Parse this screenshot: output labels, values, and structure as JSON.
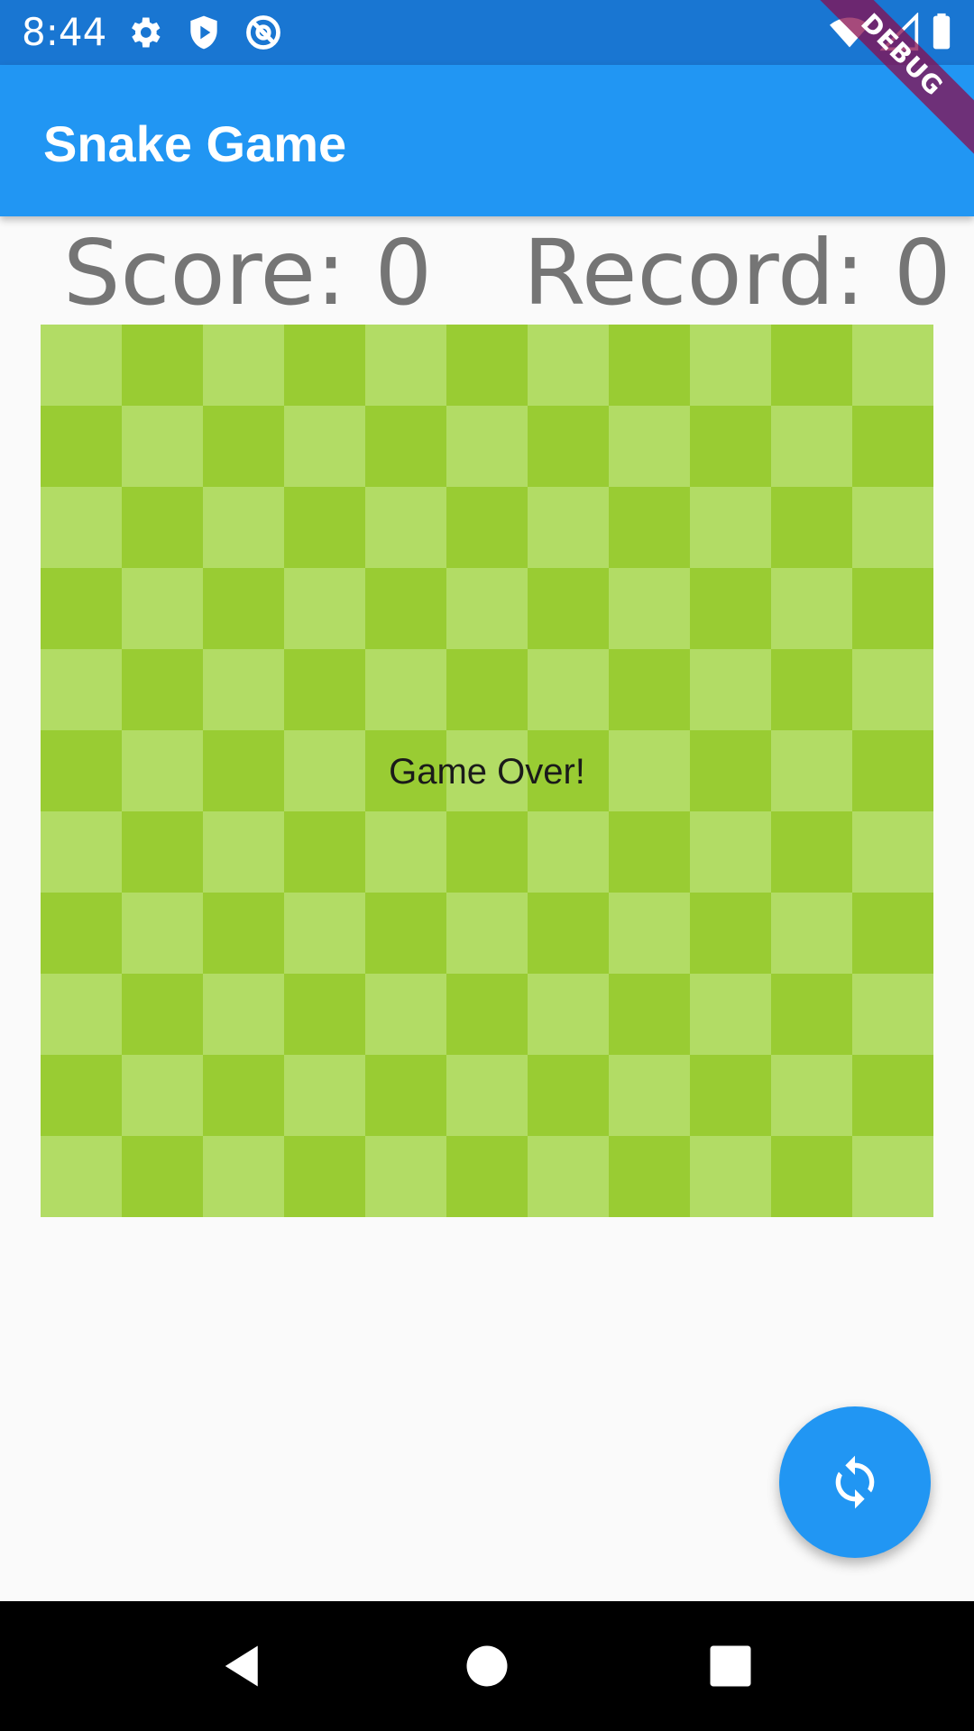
{
  "status_bar": {
    "time": "8:44",
    "icons_left": [
      "gear-icon",
      "shield-play-icon",
      "at-sign-icon"
    ],
    "icons_right": [
      "wifi-icon",
      "cell-signal-icon",
      "battery-icon"
    ],
    "background_color": "#1976d2"
  },
  "debug_banner": {
    "label": "DEBUG"
  },
  "app_bar": {
    "title": "Snake Game",
    "background_color": "#2196f3"
  },
  "scores": {
    "score_label": "Score: 0",
    "record_label": "Record: 0"
  },
  "board": {
    "rows": 11,
    "columns": 11,
    "light_color": "#b2dc65",
    "dark_color": "#99cc33",
    "message": "Game Over!"
  },
  "fab": {
    "icon": "refresh-icon",
    "color": "#2196f3"
  },
  "nav_bar": {
    "buttons": [
      "back-icon",
      "home-icon",
      "recents-icon"
    ]
  }
}
